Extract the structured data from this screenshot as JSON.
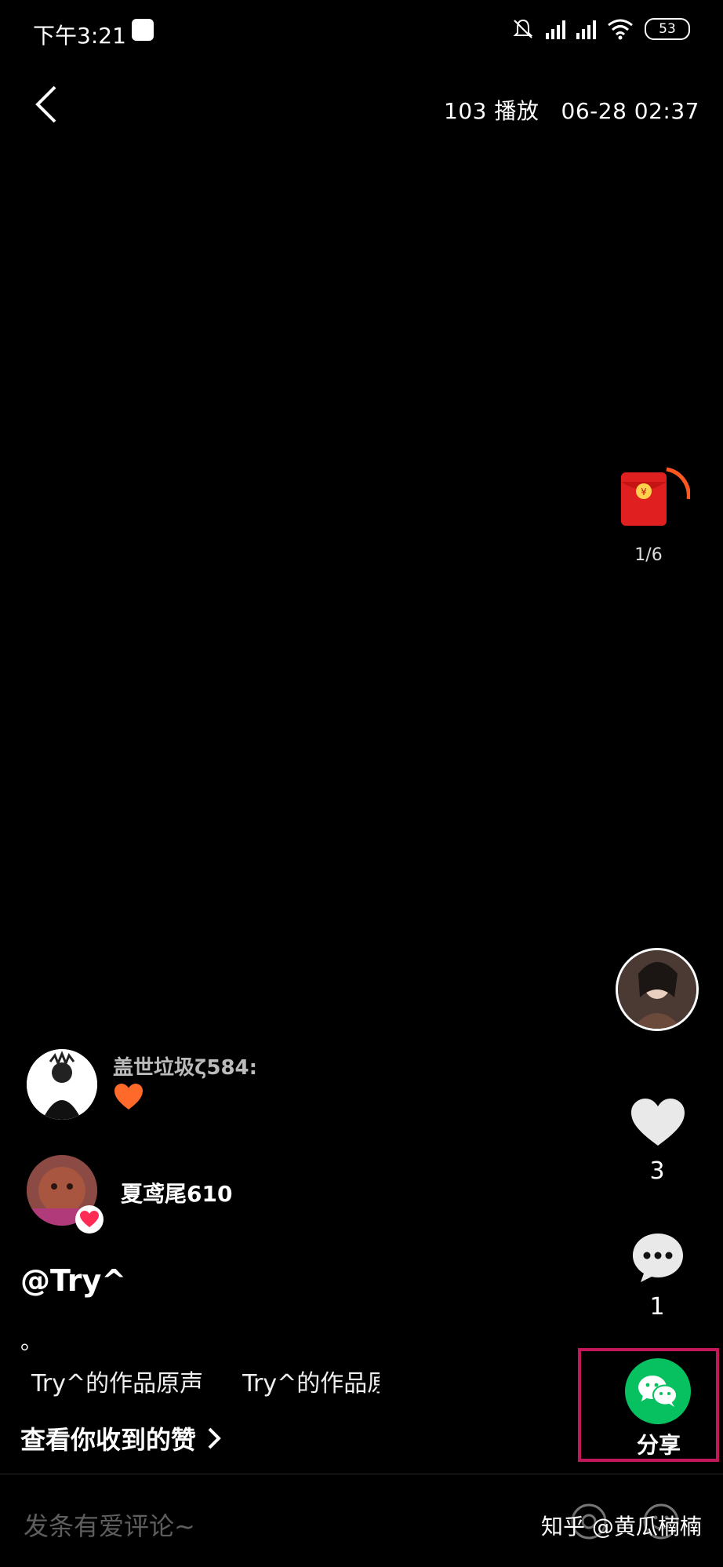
{
  "status_bar": {
    "time": "下午3:21",
    "battery": "53"
  },
  "top_bar": {
    "meta": "103 播放   06-28 02:37"
  },
  "red_packet": {
    "count": "1/6"
  },
  "actions": {
    "like_count": "3",
    "comment_count": "1",
    "share_label": "分享"
  },
  "interactions": [
    {
      "name": "盖世垃圾ζ584:"
    },
    {
      "name": "夏鸢尾610"
    }
  ],
  "post": {
    "username": "@Try^",
    "caption": "。",
    "music_1": "Try^的作品原声",
    "music_2": "Try^的作品原声",
    "likes_link": "查看你收到的赞"
  },
  "comment_bar": {
    "placeholder": "发条有爱评论~"
  },
  "watermark": "知乎 @黄瓜楠楠",
  "colors": {
    "share_green": "#07c160",
    "highlight_box": "#c2185b",
    "red_packet": "#e02020"
  }
}
